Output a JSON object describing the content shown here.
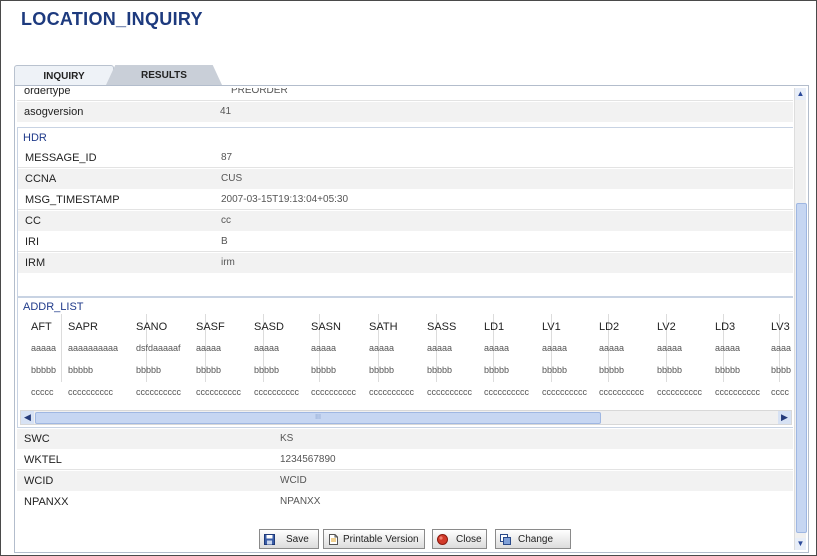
{
  "app_title": "LOCATION_INQUIRY",
  "tabs": {
    "inquiry": "INQUIRY",
    "results": "RESULTS"
  },
  "top_rows": [
    {
      "label": "ordertype",
      "value": "PREORDER"
    },
    {
      "label": "asogversion",
      "value": "41"
    }
  ],
  "hdr": {
    "title": "HDR",
    "rows": [
      {
        "label": "MESSAGE_ID",
        "value": "87"
      },
      {
        "label": "CCNA",
        "value": "CUS"
      },
      {
        "label": "MSG_TIMESTAMP",
        "value": "2007-03-15T19:13:04+05:30"
      },
      {
        "label": "CC",
        "value": "cc"
      },
      {
        "label": "IRI",
        "value": "B"
      },
      {
        "label": "IRM",
        "value": "irm"
      }
    ]
  },
  "addr_list": {
    "title": "ADDR_LIST",
    "columns": [
      "AFT",
      "SAPR",
      "SANO",
      "SASF",
      "SASD",
      "SASN",
      "SATH",
      "SASS",
      "LD1",
      "LV1",
      "LD2",
      "LV2",
      "LD3",
      "LV3"
    ],
    "rows": [
      [
        "aaaaa",
        "aaaaaaaaaa",
        "dsfdaaaaaf",
        "aaaaa",
        "aaaaa",
        "aaaaa",
        "aaaaa",
        "aaaaa",
        "aaaaa",
        "aaaaa",
        "aaaaa",
        "aaaaa",
        "aaaaa",
        "aaaa"
      ],
      [
        "bbbbb",
        "bbbbb",
        "bbbbb",
        "bbbbb",
        "bbbbb",
        "bbbbb",
        "bbbbb",
        "bbbbb",
        "bbbbb",
        "bbbbb",
        "bbbbb",
        "bbbbb",
        "bbbbb",
        "bbbb"
      ],
      [
        "ccccc",
        "cccccccccc",
        "cccccccccc",
        "cccccccccc",
        "cccccccccc",
        "cccccccccc",
        "cccccccccc",
        "cccccccccc",
        "cccccccccc",
        "cccccccccc",
        "cccccccccc",
        "cccccccccc",
        "cccccccccc",
        "cccc"
      ]
    ],
    "scroll_grip": "III"
  },
  "bottom_rows": [
    {
      "label": "SWC",
      "value": "KS"
    },
    {
      "label": "WKTEL",
      "value": "1234567890"
    },
    {
      "label": "WCID",
      "value": "WCID"
    },
    {
      "label": "NPANXX",
      "value": "NPANXX"
    }
  ],
  "buttons": {
    "save": "Save",
    "printable": "Printable Version",
    "close": "Close",
    "change": "Change"
  }
}
